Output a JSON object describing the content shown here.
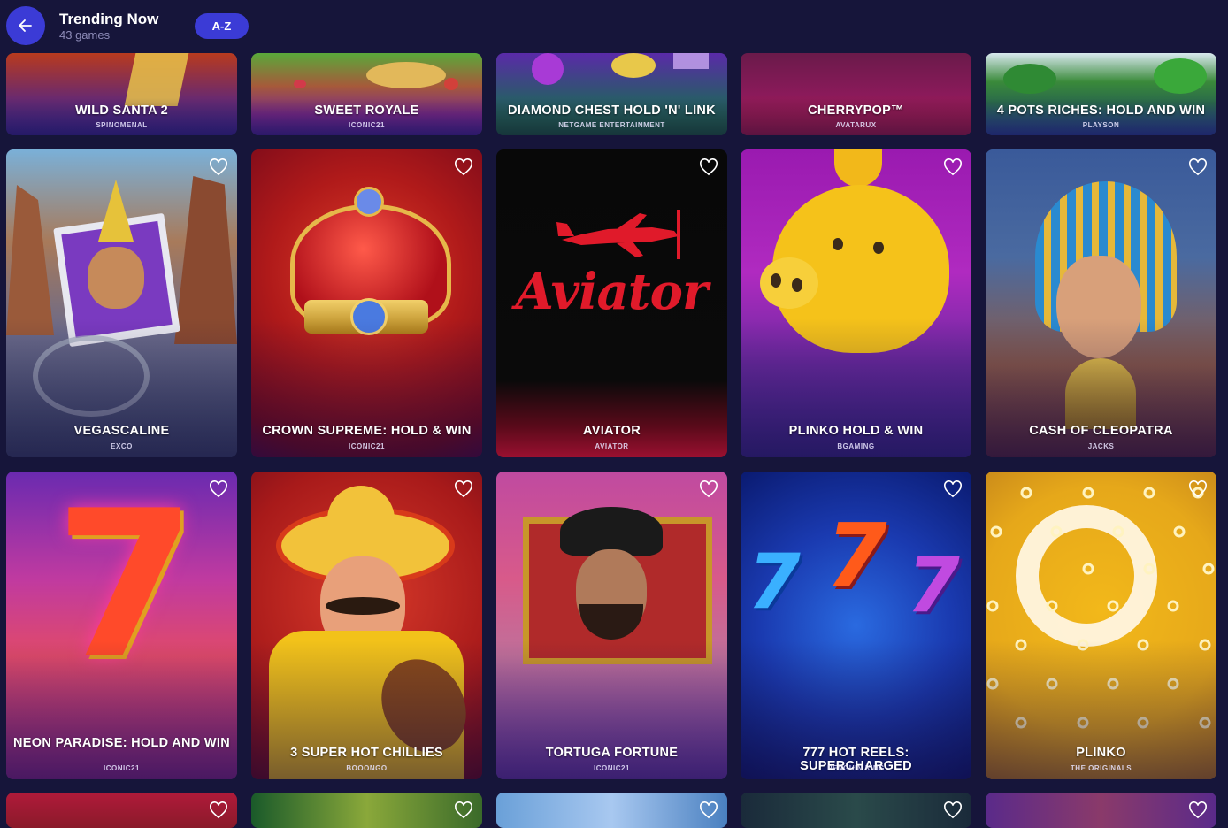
{
  "header": {
    "title": "Trending Now",
    "subtitle": "43 games",
    "sort_label": "A-Z"
  },
  "colors": {
    "accent": "#3b3bd6",
    "background": "#16153a"
  },
  "rows": [
    {
      "games": [
        {
          "name": "WILD SANTA 2",
          "provider": "SPINOMENAL"
        },
        {
          "name": "SWEET ROYALE",
          "provider": "ICONIC21"
        },
        {
          "name": "DIAMOND CHEST HOLD 'N' LINK",
          "provider": "NETGAME ENTERTAINMENT"
        },
        {
          "name": "CHERRYPOP™",
          "provider": "AVATARUX"
        },
        {
          "name": "4 POTS RICHES: HOLD AND WIN",
          "provider": "PLAYSON"
        }
      ]
    },
    {
      "games": [
        {
          "name": "VEGASCALINE",
          "provider": "EXCO"
        },
        {
          "name": "CROWN SUPREME: HOLD & WIN",
          "provider": "ICONIC21"
        },
        {
          "name": "AVIATOR",
          "provider": "AVIATOR",
          "logo_text": "Aviator"
        },
        {
          "name": "PLINKO HOLD & WIN",
          "provider": "BGAMING"
        },
        {
          "name": "CASH OF CLEOPATRA",
          "provider": "JACKS"
        }
      ]
    },
    {
      "games": [
        {
          "name": "NEON PARADISE: HOLD AND WIN",
          "provider": "ICONIC21"
        },
        {
          "name": "3 SUPER HOT CHILLIES",
          "provider": "BOOONGO"
        },
        {
          "name": "TORTUGA FORTUNE",
          "provider": "ICONIC21"
        },
        {
          "name": "777 HOT REELS: SUPERCHARGED",
          "provider": "PENGUIN KING"
        },
        {
          "name": "PLINKO",
          "provider": "THE ORIGINALS"
        }
      ]
    }
  ]
}
